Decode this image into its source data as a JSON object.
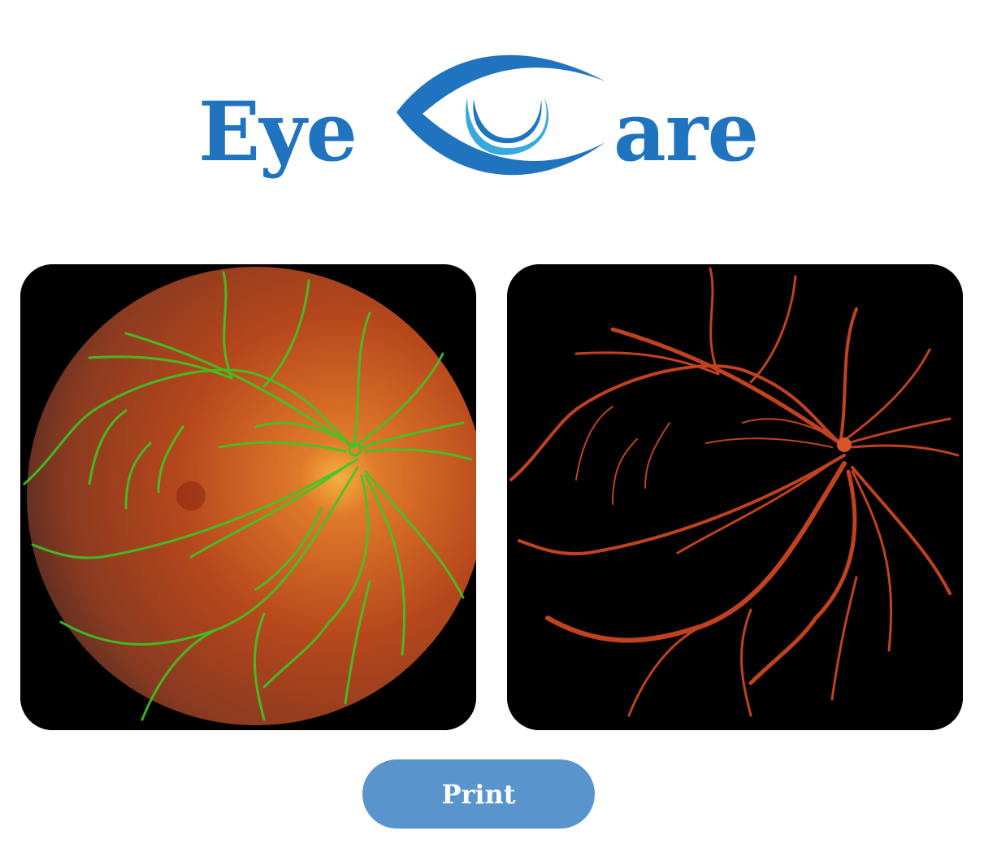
{
  "logo": {
    "word_left": "Eye",
    "word_right": "are",
    "brand_color": "#1f73bf",
    "accent_color": "#36a9e1",
    "icon": "eye-logo-icon"
  },
  "images": {
    "left": "fundus-photo-with-green-vessel-overlay",
    "right": "segmented-retinal-vessels"
  },
  "actions": {
    "print_label": "Print",
    "button_color": "#5a94cc"
  }
}
